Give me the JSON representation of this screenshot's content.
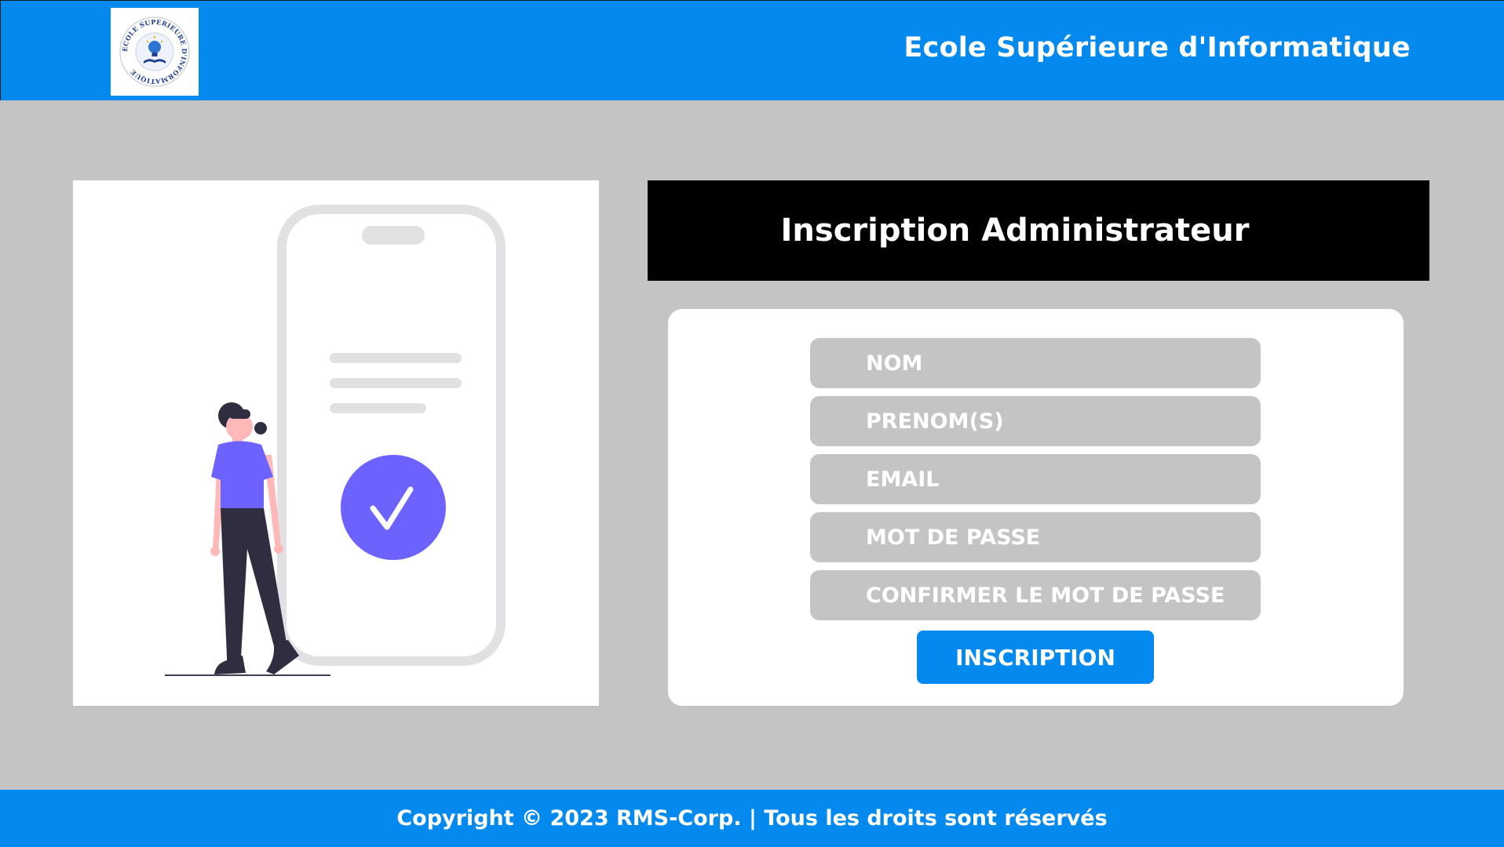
{
  "header": {
    "title": "Ecole Supérieure d'Informatique",
    "logo_text": "ECOLE SUPERIEURE D'INFORMATIQUE",
    "logo_icon": "lightbulb-book-icon"
  },
  "illustration": {
    "check_icon": "checkmark-icon",
    "check_mark": "✓"
  },
  "form": {
    "title": "Inscription Administrateur",
    "fields": {
      "nom": "NOM",
      "prenom": "PRENOM(S)",
      "email": "EMAIL",
      "password": "MOT DE PASSE",
      "confirm_password": "CONFIRMER LE MOT DE PASSE"
    },
    "submit_label": "INSCRIPTION"
  },
  "footer": {
    "copyright": "Copyright © 2023 RMS-Corp. | Tous les droits sont réservés"
  },
  "colors": {
    "primary": "#048aef",
    "background": "#c4c4c4",
    "accent": "#6c63ff",
    "title_bar": "#000000"
  }
}
